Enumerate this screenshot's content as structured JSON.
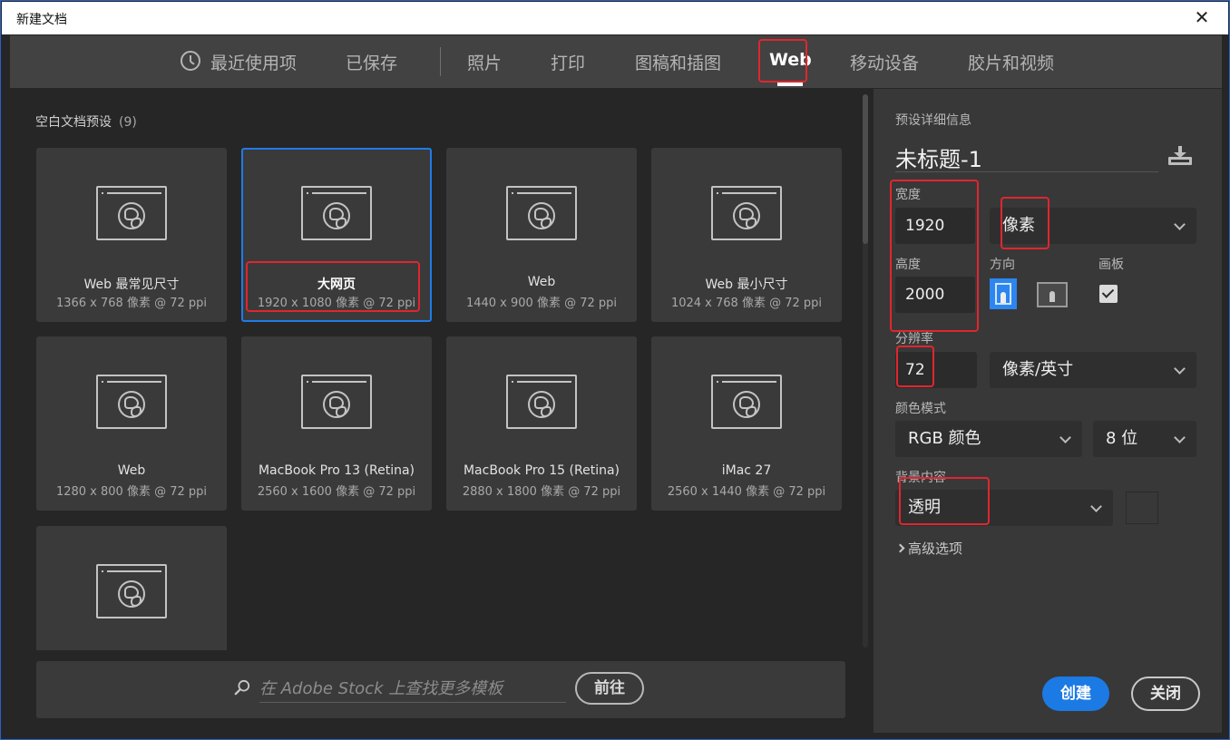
{
  "window": {
    "title": "新建文档",
    "close_glyph": "✕"
  },
  "tabs": [
    {
      "label": "最近使用项"
    },
    {
      "label": "已保存"
    },
    {
      "label": "照片"
    },
    {
      "label": "打印"
    },
    {
      "label": "图稿和插图"
    },
    {
      "label": "Web"
    },
    {
      "label": "移动设备"
    },
    {
      "label": "胶片和视频"
    }
  ],
  "active_tab": "Web",
  "presets": {
    "heading": "空白文档预设",
    "count": "(9)",
    "items": [
      {
        "name": "Web 最常见尺寸",
        "dims": "1366 x 768 像素 @ 72 ppi"
      },
      {
        "name": "大网页",
        "dims": "1920 x 1080 像素 @ 72 ppi"
      },
      {
        "name": "Web",
        "dims": "1440 x 900 像素 @ 72 ppi"
      },
      {
        "name": "Web 最小尺寸",
        "dims": "1024 x 768 像素 @ 72 ppi"
      },
      {
        "name": "Web",
        "dims": "1280 x 800 像素 @ 72 ppi"
      },
      {
        "name": "MacBook Pro 13 (Retina)",
        "dims": "2560 x 1600 像素 @ 72 ppi"
      },
      {
        "name": "MacBook Pro 15 (Retina)",
        "dims": "2880 x 1800 像素 @ 72 ppi"
      },
      {
        "name": "iMac 27",
        "dims": "2560 x 1440 像素 @ 72 ppi"
      }
    ],
    "selected": "大网页"
  },
  "stock": {
    "placeholder": "在 Adobe Stock 上查找更多模板",
    "go_label": "前往"
  },
  "details": {
    "heading": "预设详细信息",
    "doc_title": "未标题-1",
    "width_label": "宽度",
    "width_value": "1920",
    "unit_value": "像素",
    "height_label": "高度",
    "height_value": "2000",
    "orientation_label": "方向",
    "artboard_label": "画板",
    "artboard_checked": true,
    "resolution_label": "分辨率",
    "resolution_value": "72",
    "resolution_unit": "像素/英寸",
    "color_mode_label": "颜色模式",
    "color_mode_value": "RGB 颜色",
    "bit_depth_value": "8 位",
    "background_label": "背景内容",
    "background_value": "透明",
    "advanced_label": "高级选项",
    "create_label": "创建",
    "close_label": "关闭"
  },
  "colors": {
    "accent": "#1c7ae4",
    "highlight_annotation": "#e0262e",
    "panel": "#383838"
  }
}
